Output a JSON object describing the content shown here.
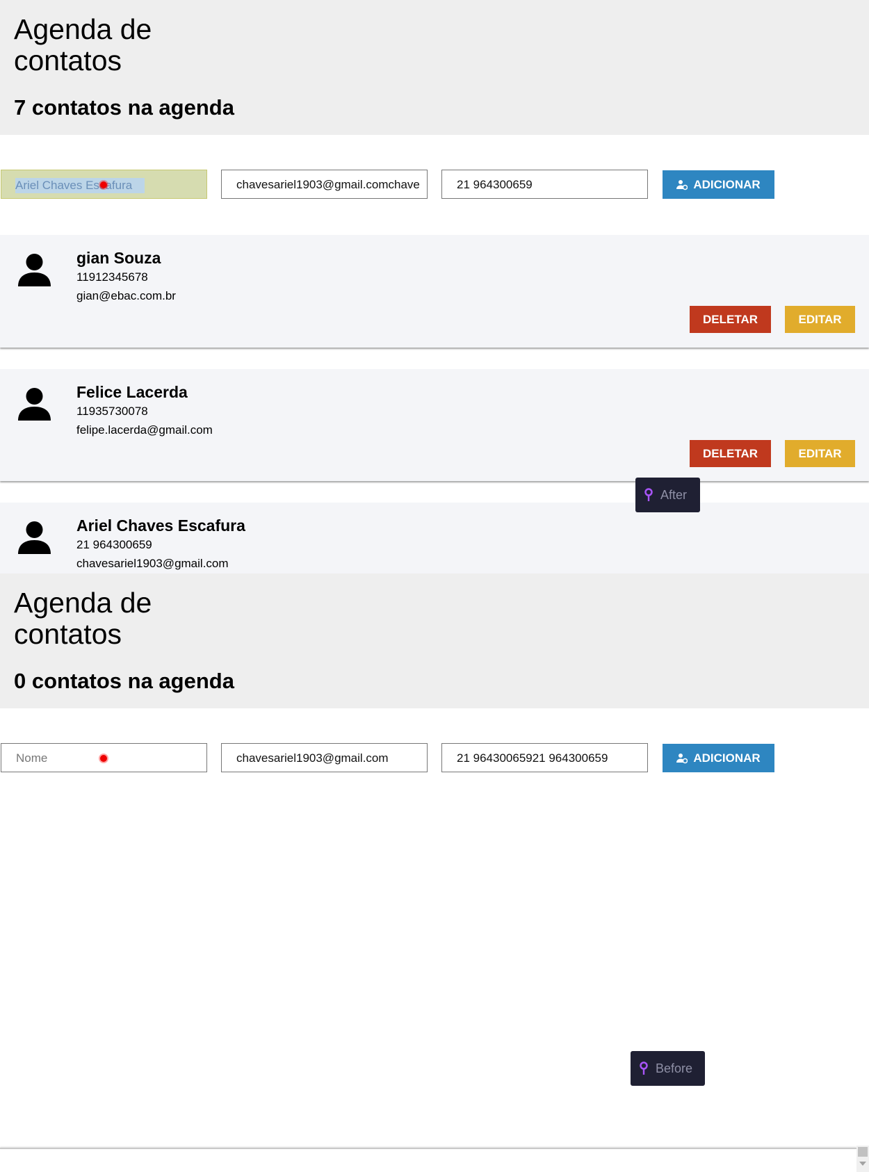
{
  "after": {
    "title_line1": "Agenda de",
    "title_line2": "contatos",
    "count_text": "7 contatos na agenda",
    "form": {
      "name_value": "Ariel Chaves Escafura",
      "email_value": "chavesariel1903@gmail.comchave",
      "phone_value": "21 964300659",
      "add_label": "ADICIONAR"
    },
    "contacts": [
      {
        "name": "gian Souza",
        "phone": "11912345678",
        "email": "gian@ebac.com.br",
        "delete_label": "DELETAR",
        "edit_label": "EDITAR"
      },
      {
        "name": "Felice Lacerda",
        "phone": "11935730078",
        "email": "felipe.lacerda@gmail.com",
        "delete_label": "DELETAR",
        "edit_label": "EDITAR"
      },
      {
        "name": "Ariel Chaves Escafura",
        "phone": "21 964300659",
        "email": "chavesariel1903@gmail.com"
      }
    ],
    "tag_label": "After"
  },
  "before": {
    "title_line1": "Agenda de",
    "title_line2": "contatos",
    "count_text": "0 contatos na agenda",
    "form": {
      "name_placeholder": "Nome",
      "email_value": "chavesariel1903@gmail.com",
      "phone_value": "21 96430065921 964300659",
      "add_label": "ADICIONAR"
    },
    "tag_label": "Before"
  },
  "colors": {
    "header_bg": "#eeeeee",
    "card_bg": "#f4f5f8",
    "add_button": "#2e86c1",
    "delete_button": "#c0391e",
    "edit_button": "#e1ac2c",
    "tag_bg": "#1f2033",
    "tag_icon": "#a855f7"
  },
  "icons": [
    "user-plus-icon",
    "person-avatar-icon",
    "map-pin-icon",
    "scroll-arrow-down-icon"
  ]
}
